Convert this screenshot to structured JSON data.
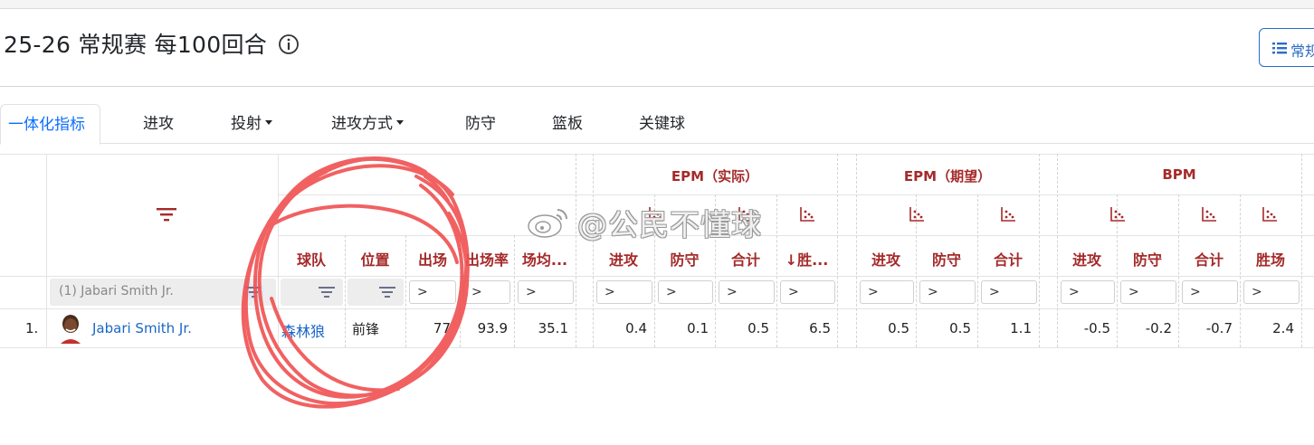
{
  "header": {
    "title": "25-26 常规赛 每100回合",
    "info_icon": "info-circle-icon",
    "view_button_label": "常规",
    "view_button_icon": "list-icon"
  },
  "tabs": [
    {
      "label": "一体化指标",
      "active": true,
      "dropdown": false
    },
    {
      "label": "进攻",
      "active": false,
      "dropdown": false
    },
    {
      "label": "投射",
      "active": false,
      "dropdown": true
    },
    {
      "label": "进攻方式",
      "active": false,
      "dropdown": true
    },
    {
      "label": "防守",
      "active": false,
      "dropdown": false
    },
    {
      "label": "篮板",
      "active": false,
      "dropdown": false
    },
    {
      "label": "关键球",
      "active": false,
      "dropdown": false
    }
  ],
  "table": {
    "groups": {
      "epm_actual": "EPM（实际）",
      "epm_expected": "EPM（期望）",
      "bpm": "BPM"
    },
    "columns": {
      "team": "球队",
      "position": "位置",
      "games": "出场",
      "games_rate": "出场率",
      "minutes": "场均...",
      "epm_off": "进攻",
      "epm_def": "防守",
      "epm_total": "合计",
      "epm_wins": "胜...",
      "xepm_off": "进攻",
      "xepm_def": "防守",
      "xepm_total": "合计",
      "bpm_off": "进攻",
      "bpm_def": "防守",
      "bpm_total": "合计",
      "bpm_wins": "胜场"
    },
    "sort_arrow": "↓",
    "filter_row": {
      "player_placeholder": "(1) Jabari Smith Jr.",
      "numeric_placeholder": ">"
    },
    "rows": [
      {
        "rank": "1.",
        "player": "Jabari Smith Jr.",
        "team": "森林狼",
        "position": "前锋",
        "games": "77",
        "games_rate": "93.9",
        "minutes": "35.1",
        "epm_off": "0.4",
        "epm_def": "0.1",
        "epm_total": "0.5",
        "epm_wins": "6.5",
        "xepm_off": "0.5",
        "xepm_def": "0.5",
        "xepm_total": "1.1",
        "bpm_off": "-0.5",
        "bpm_def": "-0.2",
        "bpm_total": "-0.7",
        "bpm_wins": "2.4"
      }
    ]
  },
  "watermark": {
    "text": "@公民不懂球",
    "icon": "weibo-icon"
  },
  "colors": {
    "accent": "#a52a2a",
    "link": "#1a66c8",
    "active_tab": "#0d6efd",
    "scribble": "#f05050"
  }
}
